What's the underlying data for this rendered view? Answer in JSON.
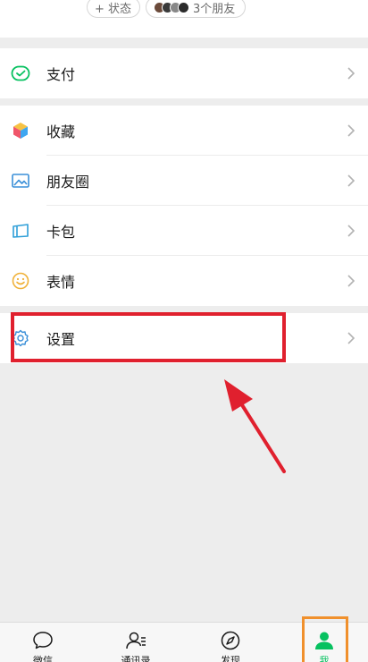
{
  "status_bar": {
    "status_label": "+ 状态",
    "friends_label": "3个朋友"
  },
  "menu": {
    "pay": {
      "label": "支付",
      "icon": "wechat-pay-icon"
    },
    "items": [
      {
        "label": "收藏",
        "icon": "cube-icon"
      },
      {
        "label": "朋友圈",
        "icon": "image-icon"
      },
      {
        "label": "卡包",
        "icon": "card-wallet-icon"
      },
      {
        "label": "表情",
        "icon": "smiley-icon"
      }
    ],
    "settings": {
      "label": "设置",
      "icon": "gear-icon"
    }
  },
  "tabbar": {
    "tabs": [
      {
        "label": "微信",
        "icon": "chat-bubble-icon",
        "active": false
      },
      {
        "label": "通讯录",
        "icon": "contacts-icon",
        "active": false
      },
      {
        "label": "发现",
        "icon": "compass-icon",
        "active": false
      },
      {
        "label": "我",
        "icon": "person-icon",
        "active": true
      }
    ]
  },
  "colors": {
    "accent": "#07c160",
    "highlight_box": "#e0202e",
    "active_tab_frame": "#f0902c"
  }
}
